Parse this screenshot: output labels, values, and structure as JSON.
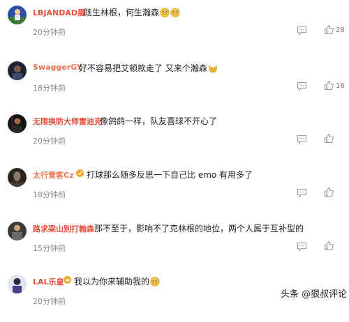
{
  "colors": {
    "username_red": "#e94e3c",
    "username_orange": "#eb7350",
    "text": "#222222",
    "time": "#888888",
    "icon": "#999999"
  },
  "comments": [
    {
      "username": "LBJANDAD眉",
      "text": "既生林根，何生瀚森",
      "emoji": [
        "grin-sweat-emoji",
        "grin-sweat-emoji"
      ],
      "time": "20分钟前",
      "likes": "28"
    },
    {
      "username": "SwaggerGY",
      "text": "好不容易把艾顿款走了 又来个瀚森",
      "emoji": [
        "cat-face-emoji"
      ],
      "time": "18分钟前",
      "likes": "16"
    },
    {
      "username": "无限换防大师雷迪克",
      "text": "像鸽鸽一样，队友喜球不开心了",
      "emoji": [],
      "time": "20分钟前",
      "likes": ""
    },
    {
      "username": "太行雪客Cz",
      "text": "打球那么随多反思一下自己比 emo 有用多了",
      "emoji": [],
      "time": "18分钟前",
      "likes": ""
    },
    {
      "username": "路求梁山别打翰森",
      "text": "那不至于，影响不了克林根的地位，两个人属于互补型的",
      "emoji": [],
      "time": "15分钟前",
      "likes": ""
    },
    {
      "username": "LAL乐皇",
      "text": "我以为你来辅助我的",
      "emoji": [
        "grin-sweat-emoji"
      ],
      "time": "20分钟前",
      "likes": ""
    }
  ],
  "watermark": "头条 @狠叔评论"
}
